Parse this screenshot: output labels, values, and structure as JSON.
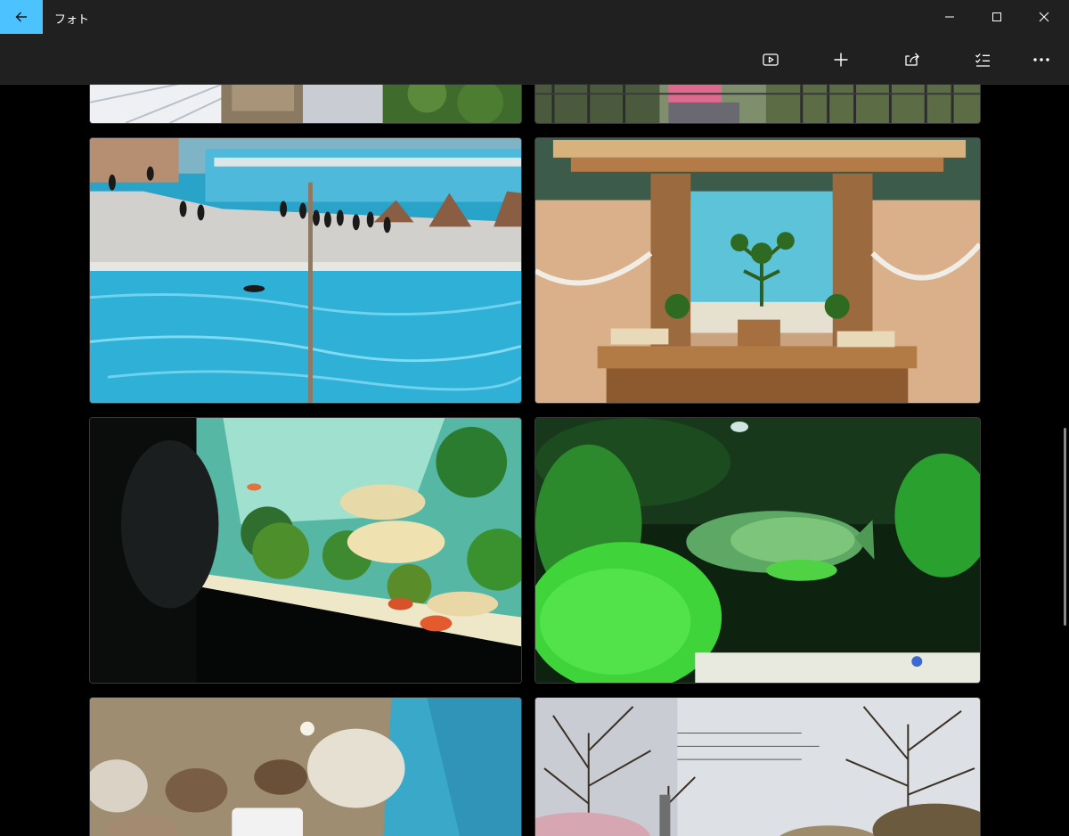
{
  "window": {
    "title": "フォト",
    "controls": {
      "minimize_icon": "minimize-icon",
      "maximize_icon": "maximize-icon",
      "close_icon": "close-icon"
    }
  },
  "colors": {
    "accent": "#4cc2ff",
    "titlebar": "#202020",
    "background": "#000000"
  },
  "toolbar": {
    "buttons": [
      {
        "name": "slideshow-button",
        "icon": "slideshow-icon"
      },
      {
        "name": "add-button",
        "icon": "plus-icon"
      },
      {
        "name": "share-button",
        "icon": "share-icon"
      },
      {
        "name": "select-button",
        "icon": "checklist-icon"
      },
      {
        "name": "more-button",
        "icon": "more-icon"
      }
    ]
  },
  "gallery": {
    "photos": [
      {
        "name": "photo-building-top"
      },
      {
        "name": "photo-railing-top"
      },
      {
        "name": "photo-penguin-pool"
      },
      {
        "name": "photo-aquarium-shrine"
      },
      {
        "name": "photo-fish-tank"
      },
      {
        "name": "photo-green-coral-fish"
      },
      {
        "name": "photo-rocks-tank"
      },
      {
        "name": "photo-trees-sky"
      }
    ],
    "scroll_position": 0.55
  }
}
